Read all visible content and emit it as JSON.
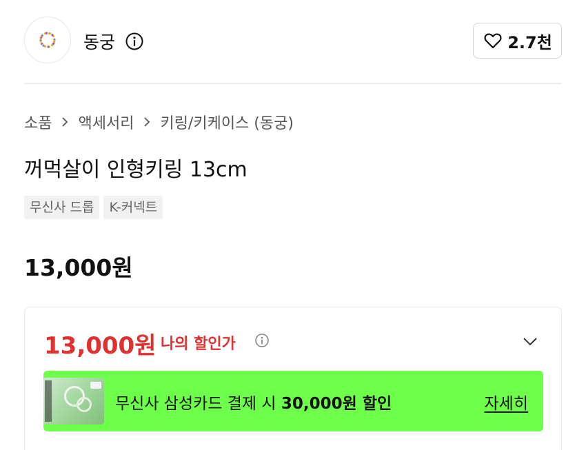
{
  "brand": {
    "name": "동궁",
    "logo_icon": "brand-logo-ring",
    "info_icon": "info-icon"
  },
  "like": {
    "icon": "heart-outline-icon",
    "count": "2.7천"
  },
  "breadcrumb": {
    "items": [
      "소품",
      "액세서리",
      "키링/키케이스 (동궁)"
    ],
    "separator_icon": "chevron-right-icon"
  },
  "product": {
    "title": "꺼먹살이 인형키링 13cm",
    "tags": [
      "무신사 드롭",
      "K-커넥트"
    ],
    "price": "13,000원"
  },
  "discount": {
    "my_price": "13,000원",
    "my_price_label": "나의 할인가",
    "info_icon": "info-icon",
    "expand_icon": "chevron-down-icon",
    "promo": {
      "text_prefix": "무신사 삼성카드 결제 시 ",
      "text_highlight": "30,000원 할인",
      "link": "자세히",
      "bg_color": "#6eff4a",
      "card_icon": "card-image"
    }
  },
  "colors": {
    "accent_red": "#e03131",
    "promo_green": "#6eff4a"
  }
}
